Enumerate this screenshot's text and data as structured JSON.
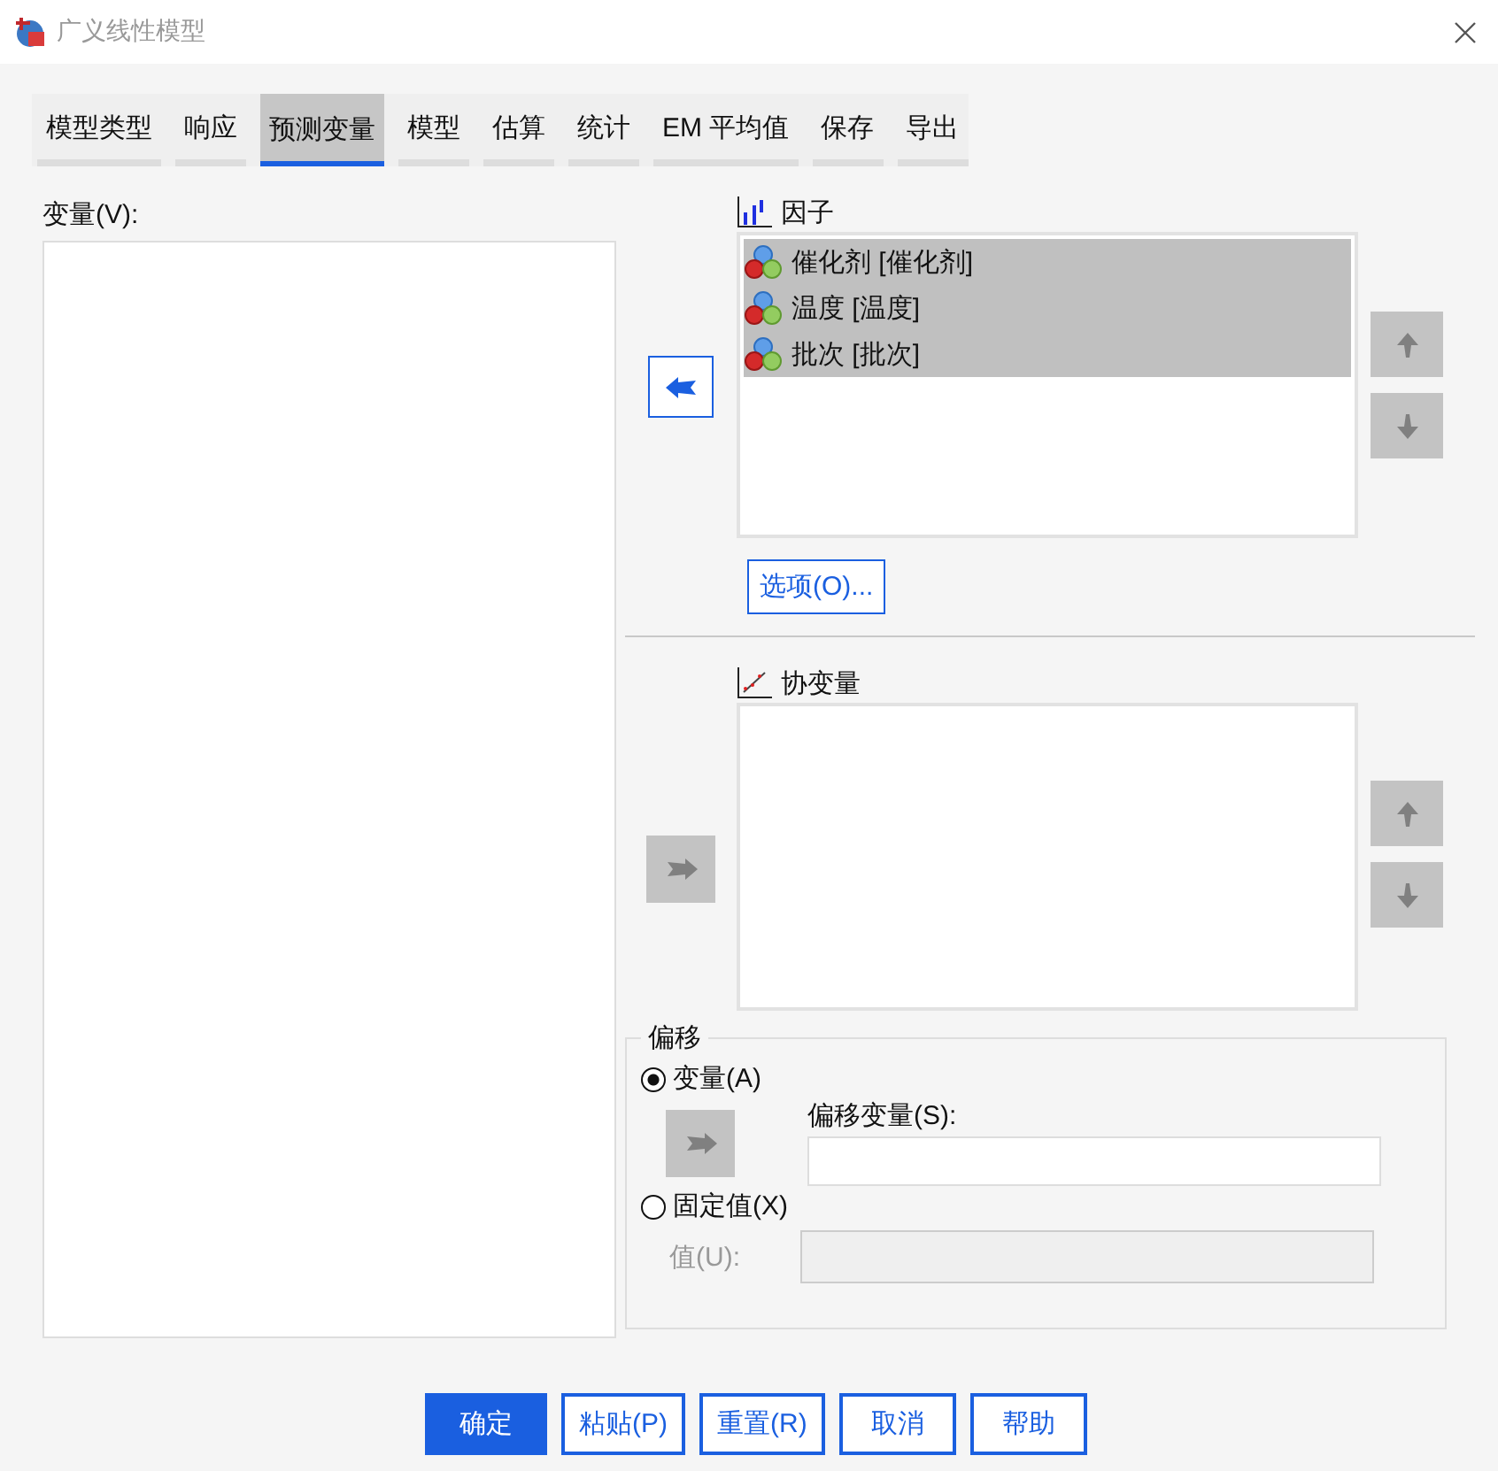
{
  "window": {
    "title": "广义线性模型"
  },
  "tabs": [
    {
      "label": "模型类型",
      "selected": false
    },
    {
      "label": "响应",
      "selected": false
    },
    {
      "label": "预测变量",
      "selected": true
    },
    {
      "label": "模型",
      "selected": false
    },
    {
      "label": "估算",
      "selected": false
    },
    {
      "label": "统计",
      "selected": false
    },
    {
      "label": "EM 平均值",
      "selected": false
    },
    {
      "label": "保存",
      "selected": false
    },
    {
      "label": "导出",
      "selected": false
    }
  ],
  "variables": {
    "label": "变量(V):"
  },
  "factors": {
    "label": "因子",
    "transfer_enabled": true,
    "items": [
      {
        "text": "催化剂 [催化剂]",
        "selected": true
      },
      {
        "text": "温度 [温度]",
        "selected": true
      },
      {
        "text": "批次 [批次]",
        "selected": true
      }
    ],
    "options_button": "选项(O)..."
  },
  "covariates": {
    "label": "协变量",
    "transfer_enabled": false
  },
  "offset": {
    "title": "偏移",
    "options": [
      {
        "label": "变量(A)",
        "selected": true
      },
      {
        "label": "固定值(X)",
        "selected": false
      }
    ],
    "offset_variable": {
      "label": "偏移变量(S):",
      "transfer_enabled": false
    },
    "value": {
      "label": "值(U):",
      "disabled": true
    }
  },
  "buttons": [
    {
      "label": "确定",
      "primary": true
    },
    {
      "label": "粘贴(P)",
      "primary": false
    },
    {
      "label": "重置(R)",
      "primary": false
    },
    {
      "label": "取消",
      "primary": false
    },
    {
      "label": "帮助",
      "primary": false
    }
  ]
}
